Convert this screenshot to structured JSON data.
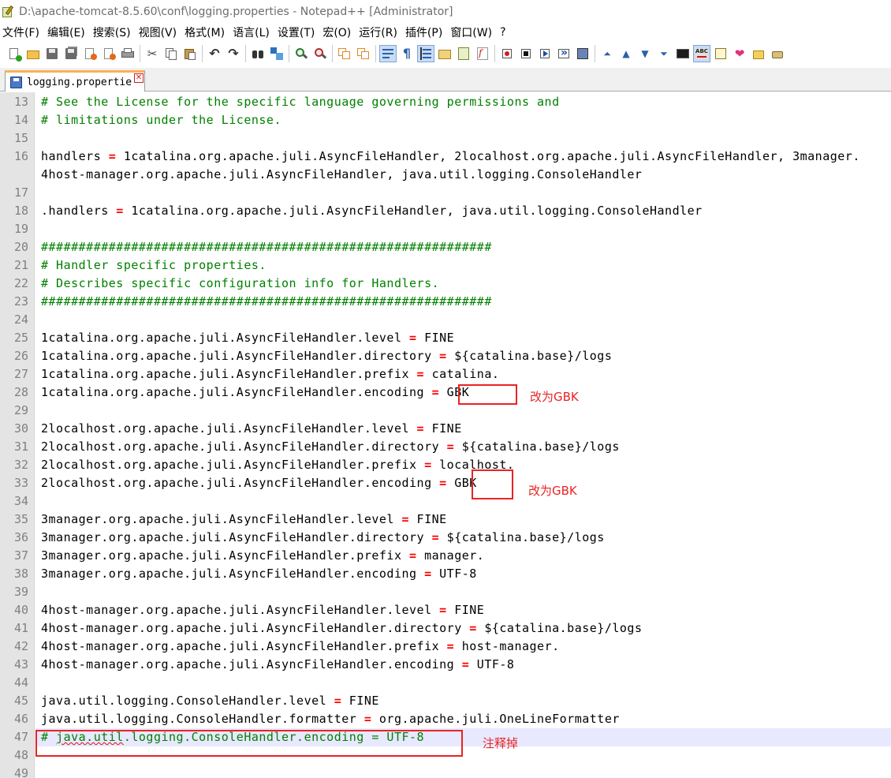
{
  "window": {
    "title": "D:\\apache-tomcat-8.5.60\\conf\\logging.properties - Notepad++ [Administrator]"
  },
  "menu": [
    "文件(F)",
    "编辑(E)",
    "搜索(S)",
    "视图(V)",
    "格式(M)",
    "语言(L)",
    "设置(T)",
    "宏(O)",
    "运行(R)",
    "插件(P)",
    "窗口(W)",
    "?"
  ],
  "tab": {
    "label": "logging.propertie",
    "close_glyph": "✕"
  },
  "editor": {
    "current_line": 47,
    "lines": [
      {
        "n": "13",
        "text": "# See the License for the specific language governing permissions and",
        "type": "comment"
      },
      {
        "n": "14",
        "text": "# limitations under the License.",
        "type": "comment"
      },
      {
        "n": "15",
        "text": "",
        "type": "plain"
      },
      {
        "n": "16",
        "key": "handlers",
        "value": "1catalina.org.apache.juli.AsyncFileHandler, 2localhost.org.apache.juli.AsyncFileHandler, 3manager.",
        "type": "kv"
      },
      {
        "n": "",
        "text": "4host-manager.org.apache.juli.AsyncFileHandler, java.util.logging.ConsoleHandler",
        "type": "plain"
      },
      {
        "n": "17",
        "text": "",
        "type": "plain"
      },
      {
        "n": "18",
        "key": ".handlers",
        "value": "1catalina.org.apache.juli.AsyncFileHandler, java.util.logging.ConsoleHandler",
        "type": "kv"
      },
      {
        "n": "19",
        "text": "",
        "type": "plain"
      },
      {
        "n": "20",
        "text": "############################################################",
        "type": "comment"
      },
      {
        "n": "21",
        "text": "# Handler specific properties.",
        "type": "comment"
      },
      {
        "n": "22",
        "text": "# Describes specific configuration info for Handlers.",
        "type": "comment"
      },
      {
        "n": "23",
        "text": "############################################################",
        "type": "comment"
      },
      {
        "n": "24",
        "text": "",
        "type": "plain"
      },
      {
        "n": "25",
        "key": "1catalina.org.apache.juli.AsyncFileHandler.level",
        "value": "FINE",
        "type": "kv"
      },
      {
        "n": "26",
        "key": "1catalina.org.apache.juli.AsyncFileHandler.directory",
        "value": "${catalina.base}/logs",
        "type": "kv"
      },
      {
        "n": "27",
        "key": "1catalina.org.apache.juli.AsyncFileHandler.prefix",
        "value": "catalina.",
        "type": "kv"
      },
      {
        "n": "28",
        "key": "1catalina.org.apache.juli.AsyncFileHandler.encoding",
        "value": "GBK",
        "type": "kv"
      },
      {
        "n": "29",
        "text": "",
        "type": "plain"
      },
      {
        "n": "30",
        "key": "2localhost.org.apache.juli.AsyncFileHandler.level",
        "value": "FINE",
        "type": "kv"
      },
      {
        "n": "31",
        "key": "2localhost.org.apache.juli.AsyncFileHandler.directory",
        "value": "${catalina.base}/logs",
        "type": "kv"
      },
      {
        "n": "32",
        "key": "2localhost.org.apache.juli.AsyncFileHandler.prefix",
        "value": "localhost.",
        "type": "kv"
      },
      {
        "n": "33",
        "key": "2localhost.org.apache.juli.AsyncFileHandler.encoding",
        "value": "GBK",
        "type": "kv"
      },
      {
        "n": "34",
        "text": "",
        "type": "plain"
      },
      {
        "n": "35",
        "key": "3manager.org.apache.juli.AsyncFileHandler.level",
        "value": "FINE",
        "type": "kv"
      },
      {
        "n": "36",
        "key": "3manager.org.apache.juli.AsyncFileHandler.directory",
        "value": "${catalina.base}/logs",
        "type": "kv"
      },
      {
        "n": "37",
        "key": "3manager.org.apache.juli.AsyncFileHandler.prefix",
        "value": "manager.",
        "type": "kv"
      },
      {
        "n": "38",
        "key": "3manager.org.apache.juli.AsyncFileHandler.encoding",
        "value": "UTF-8",
        "type": "kv"
      },
      {
        "n": "39",
        "text": "",
        "type": "plain"
      },
      {
        "n": "40",
        "key": "4host-manager.org.apache.juli.AsyncFileHandler.level",
        "value": "FINE",
        "type": "kv"
      },
      {
        "n": "41",
        "key": "4host-manager.org.apache.juli.AsyncFileHandler.directory",
        "value": "${catalina.base}/logs",
        "type": "kv"
      },
      {
        "n": "42",
        "key": "4host-manager.org.apache.juli.AsyncFileHandler.prefix",
        "value": "host-manager.",
        "type": "kv"
      },
      {
        "n": "43",
        "key": "4host-manager.org.apache.juli.AsyncFileHandler.encoding",
        "value": "UTF-8",
        "type": "kv"
      },
      {
        "n": "44",
        "text": "",
        "type": "plain"
      },
      {
        "n": "45",
        "key": "java.util.logging.ConsoleHandler.level",
        "value": "FINE",
        "type": "kv"
      },
      {
        "n": "46",
        "key": "java.util.logging.ConsoleHandler.formatter",
        "value": "org.apache.juli.OneLineFormatter",
        "type": "kv"
      },
      {
        "n": "47",
        "text": "# java.util.logging.ConsoleHandler.encoding = UTF-8",
        "type": "comment",
        "squiggle": "java.util"
      },
      {
        "n": "48",
        "text": "",
        "type": "plain"
      },
      {
        "n": "49",
        "text": "",
        "type": "plain"
      }
    ]
  },
  "annotations": {
    "note_gbk": "改为GBK",
    "note_comment_out": "注释掉"
  },
  "colors": {
    "comment": "#008000",
    "operator": "#ff0000",
    "annotation": "#e82424",
    "current_line_bg": "#e8e8ff",
    "tab_accent": "#fab15a"
  }
}
